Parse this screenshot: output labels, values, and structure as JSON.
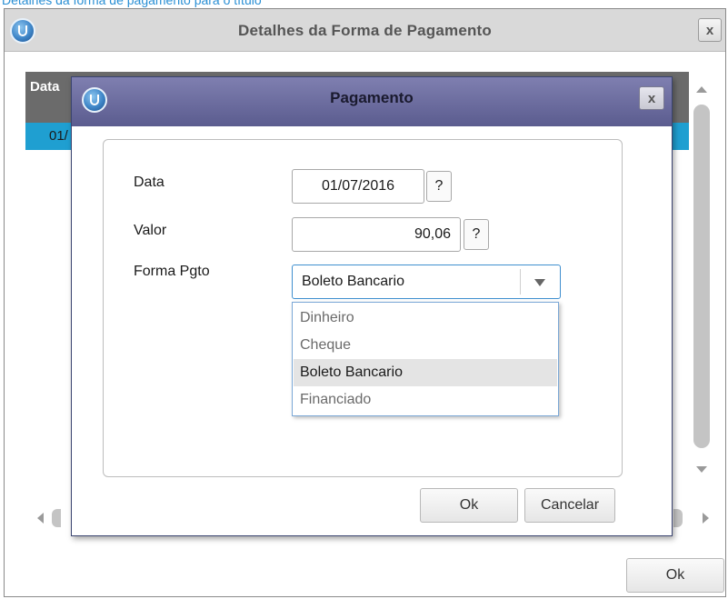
{
  "top_caption": "Detalhes da forma de pagamento para o título",
  "outer_window": {
    "title": "Detalhes da Forma de Pagamento",
    "close_label": "x",
    "grid_header": "Data",
    "grid_selected_cell": "01/",
    "ok_label": "Ok"
  },
  "dialog": {
    "title": "Pagamento",
    "close_label": "x",
    "fields": {
      "data_label": "Data",
      "data_value": "01/07/2016",
      "valor_label": "Valor",
      "valor_value": "90,06",
      "help_label": "?",
      "forma_label": "Forma Pgto",
      "forma_value": "Boleto Bancario"
    },
    "options": [
      "Dinheiro",
      "Cheque",
      "Boleto Bancario",
      "Financiado"
    ],
    "selected_option_index": 2,
    "ok_label": "Ok",
    "cancel_label": "Cancelar"
  },
  "colors": {
    "dialog_title_bar": "#6b6c9f",
    "grid_selection": "#1f9fd1",
    "combo_focus_border": "#3f8fcf"
  }
}
